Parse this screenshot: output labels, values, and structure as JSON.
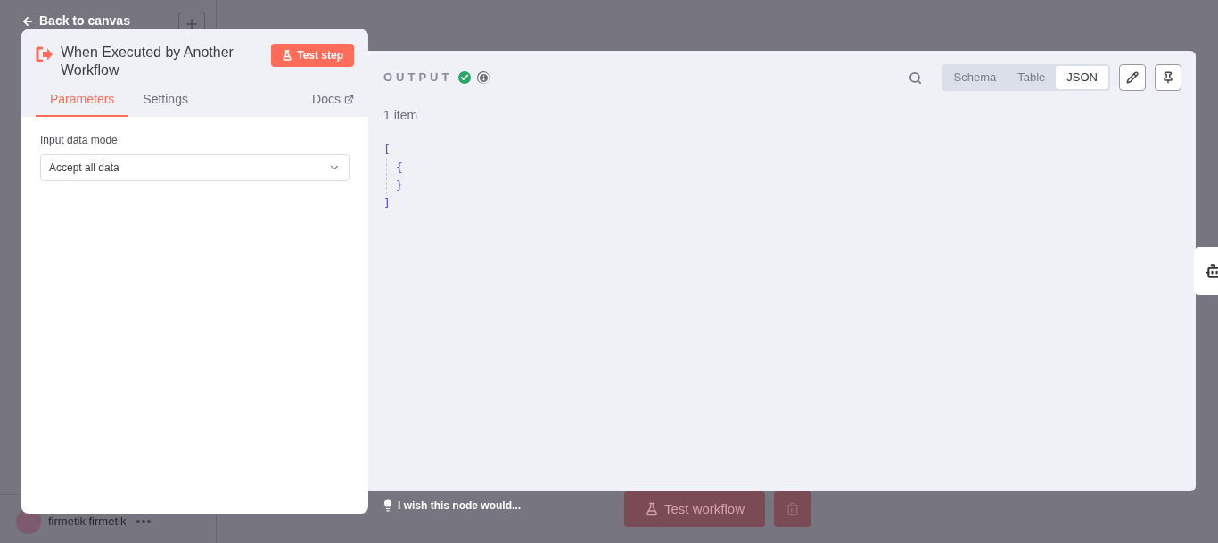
{
  "back_link": "Back to canvas",
  "node": {
    "title": "When Executed by Another Workflow",
    "test_button": "Test step"
  },
  "tabs": [
    {
      "label": "Parameters",
      "selected": true
    },
    {
      "label": "Settings",
      "selected": false
    }
  ],
  "docs_link": "Docs",
  "parameters": [
    {
      "label": "Input data mode",
      "value": "Accept all data"
    }
  ],
  "output": {
    "title": "OUTPUT",
    "succeeded": true,
    "item_count": "1 item",
    "views": [
      {
        "label": "Schema",
        "selected": false
      },
      {
        "label": "Table",
        "selected": false
      },
      {
        "label": "JSON",
        "selected": true
      }
    ],
    "json": {
      "open": "[",
      "close": "]",
      "children": [
        {
          "open": "{",
          "close": "}"
        }
      ]
    }
  },
  "feedback": "I wish this node would...",
  "canvas": {
    "test_button": "Test workflow",
    "user": {
      "name": "firmetik firmetik"
    }
  }
}
